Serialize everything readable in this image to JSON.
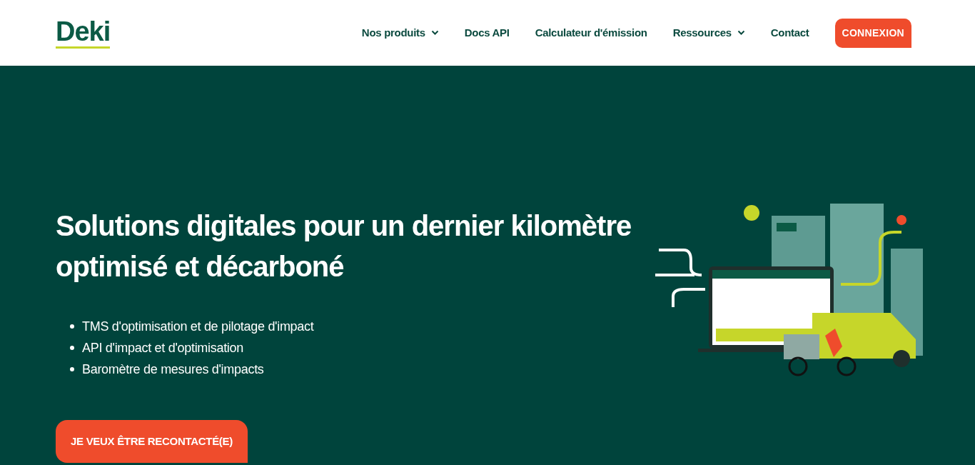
{
  "logo": {
    "text": "Deki"
  },
  "nav": [
    {
      "label": "Nos produits",
      "dropdown": true
    },
    {
      "label": "Docs API",
      "dropdown": false
    },
    {
      "label": "Calculateur d'émission",
      "dropdown": false
    },
    {
      "label": "Ressources",
      "dropdown": true
    },
    {
      "label": "Contact",
      "dropdown": false
    }
  ],
  "login_button": "CONNEXION",
  "hero": {
    "title": "Solutions digitales pour un dernier kilomètre optimisé et décarboné",
    "bullets": [
      "TMS d'optimisation et de pilotage d'impact",
      "API d'impact et d'optimisation",
      "Baromètre de mesures d'impacts"
    ],
    "cta": "JE VEUX ÊTRE RECONTACTÉ(E)"
  }
}
